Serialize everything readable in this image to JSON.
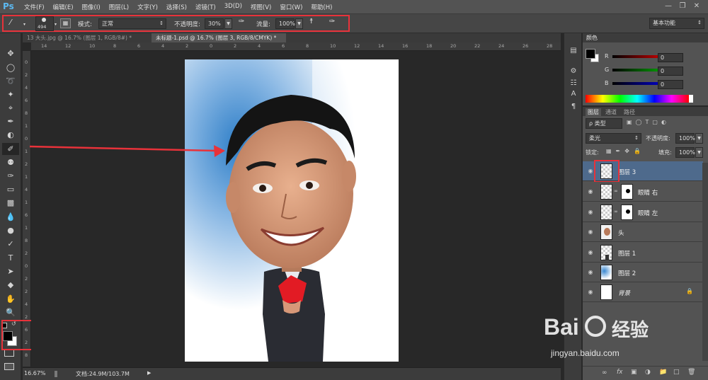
{
  "app": {
    "logo": "Ps"
  },
  "menu": [
    "文件(F)",
    "编辑(E)",
    "图像(I)",
    "图层(L)",
    "文字(Y)",
    "选择(S)",
    "滤镜(T)",
    "3D(D)",
    "视图(V)",
    "窗口(W)",
    "帮助(H)"
  ],
  "options": {
    "brush_size": "494",
    "mode_label": "模式:",
    "mode_value": "正常",
    "opacity_label": "不透明度:",
    "opacity_value": "30%",
    "flow_label": "流量:",
    "flow_value": "100%",
    "workspace": "基本功能"
  },
  "tabs": [
    {
      "label": "13 大头.jpg @ 16.7% (图层 1, RGB/8#) *"
    },
    {
      "label": "未标题-1.psd @ 16.7% (图层 3, RGB/8/CMYK) *"
    }
  ],
  "ruler_top": [
    "14",
    "12",
    "10",
    "8",
    "6",
    "4",
    "2",
    "0",
    "2",
    "4",
    "6",
    "8",
    "10",
    "12",
    "14",
    "16",
    "18",
    "20",
    "22",
    "24",
    "26",
    "28"
  ],
  "ruler_left": [
    "0",
    "2",
    "4",
    "6",
    "8",
    "1",
    "0",
    "1",
    "2",
    "1",
    "4",
    "1",
    "6",
    "1",
    "8",
    "2",
    "0",
    "2",
    "2",
    "4",
    "2",
    "6",
    "2",
    "8"
  ],
  "status": {
    "zoom": "16.67%",
    "doc": "文档:24.9M/103.7M"
  },
  "color_panel": {
    "title": "颜色",
    "r_label": "R",
    "r_value": "0",
    "g_label": "G",
    "g_value": "0",
    "b_label": "B",
    "b_value": "0"
  },
  "layers_panel": {
    "tabs": [
      "图层",
      "通道",
      "路径"
    ],
    "filter": "ρ 类型",
    "blend": "柔光",
    "opacity_label": "不透明度:",
    "opacity_value": "100%",
    "lock_label": "锁定:",
    "fill_label": "填充:",
    "fill_value": "100%",
    "layers": [
      {
        "name": "图层 3"
      },
      {
        "name": "眼睛 右"
      },
      {
        "name": "眼睛 左"
      },
      {
        "name": "头"
      },
      {
        "name": "图层 1"
      },
      {
        "name": "图层 2"
      },
      {
        "name": "背景"
      }
    ],
    "footer_icons": [
      "link-icon",
      "fx-icon",
      "mask-icon",
      "adjustment-icon",
      "group-icon",
      "new-layer-icon",
      "trash-icon"
    ]
  },
  "watermark": {
    "brand": "Bai",
    "brand2": "经验",
    "url": "jingyan.baidu.com"
  },
  "colors": {
    "accent": "#e8323a",
    "panel": "#535353",
    "dark": "#282828"
  }
}
